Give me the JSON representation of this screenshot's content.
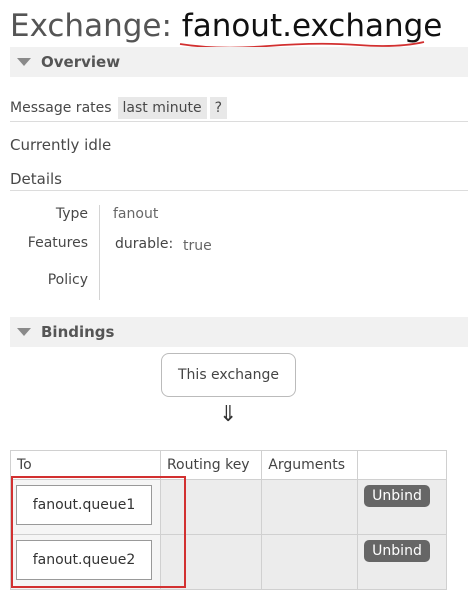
{
  "title": {
    "prefix": "Exchange: ",
    "name": "fanout.exchange"
  },
  "overview": {
    "header": "Overview",
    "message_rates_label": "Message rates",
    "rate_window": "last minute",
    "help": "?",
    "idle_text": "Currently idle",
    "details_label": "Details",
    "type_label": "Type",
    "type_value": "fanout",
    "features_label": "Features",
    "durable_key": "durable:",
    "durable_value": "true",
    "policy_label": "Policy",
    "policy_value": ""
  },
  "bindings": {
    "header": "Bindings",
    "this_exchange": "This exchange",
    "arrow": "⇓",
    "columns": [
      "To",
      "Routing key",
      "Arguments",
      ""
    ],
    "rows": [
      {
        "to": "fanout.queue1",
        "routing_key": "",
        "arguments": "",
        "action": "Unbind"
      },
      {
        "to": "fanout.queue2",
        "routing_key": "",
        "arguments": "",
        "action": "Unbind"
      }
    ]
  },
  "colors": {
    "annotation_red": "#d23030",
    "header_bg": "#f1f1f1",
    "button_bg": "#666666"
  },
  "icons": {
    "collapse": "triangle-down-icon"
  }
}
